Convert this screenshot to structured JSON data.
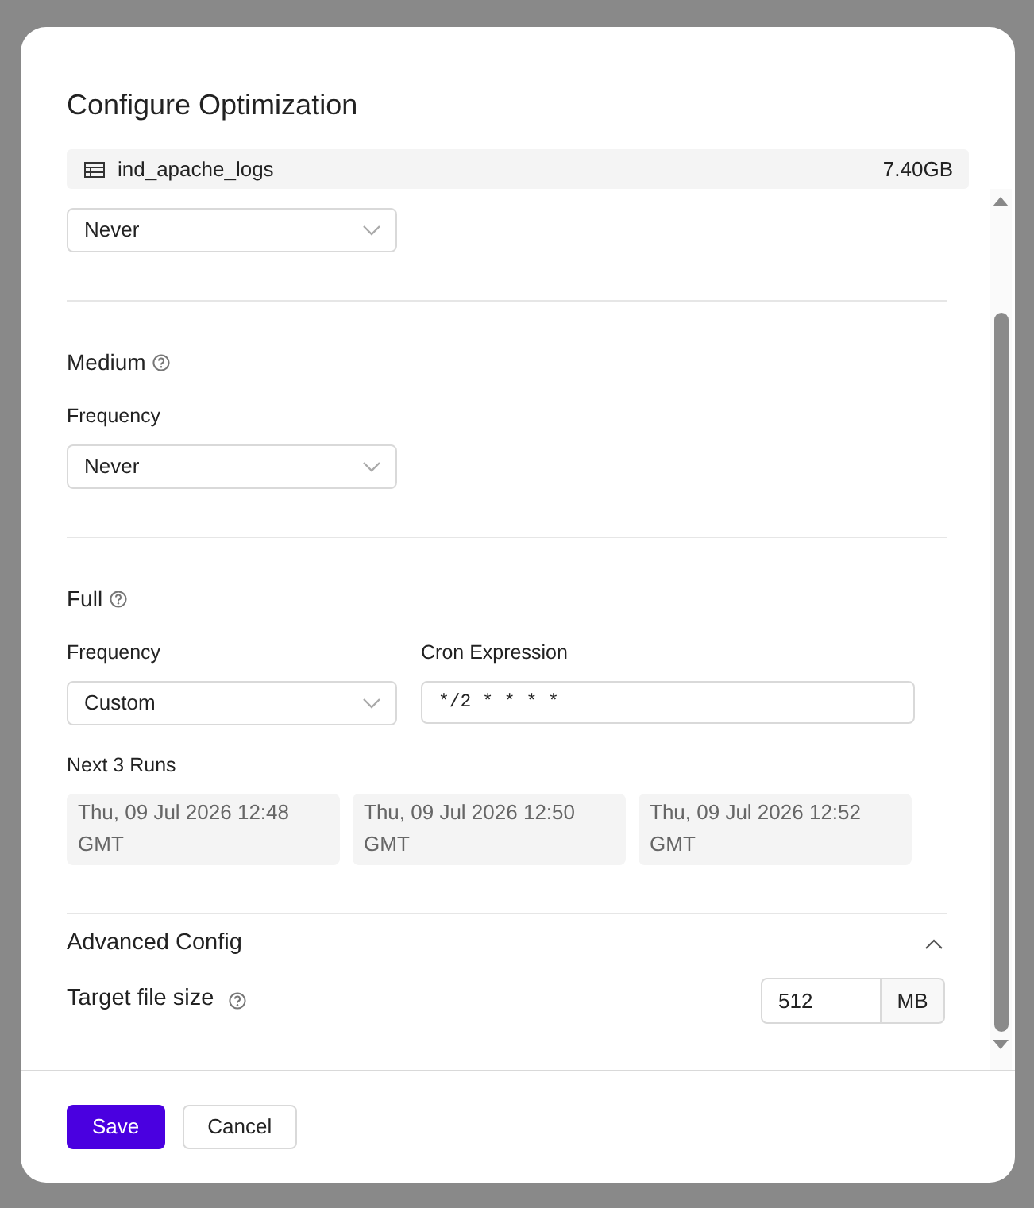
{
  "dialog": {
    "title": "Configure Optimization",
    "table": {
      "name": "ind_apache_logs",
      "size": "7.40GB"
    }
  },
  "sections": [
    {
      "frequency_value": "Never"
    },
    {
      "heading": "Medium",
      "frequency_label": "Frequency",
      "frequency_value": "Never"
    },
    {
      "heading": "Full",
      "frequency_label": "Frequency",
      "frequency_value": "Custom",
      "cron_label": "Cron Expression",
      "cron_value": "*/2 * * * *",
      "next_runs_label": "Next 3 Runs",
      "next_runs": [
        "Thu, 09 Jul 2026 12:48 GMT",
        "Thu, 09 Jul 2026 12:50 GMT",
        "Thu, 09 Jul 2026 12:52 GMT"
      ]
    }
  ],
  "advanced": {
    "title": "Advanced Config",
    "expanded": true,
    "target_label": "Target file size",
    "target_value": "512",
    "unit": "MB"
  },
  "buttons": [
    {
      "label": "Save",
      "kind": "primary"
    },
    {
      "label": "Cancel",
      "kind": "secondary"
    }
  ]
}
